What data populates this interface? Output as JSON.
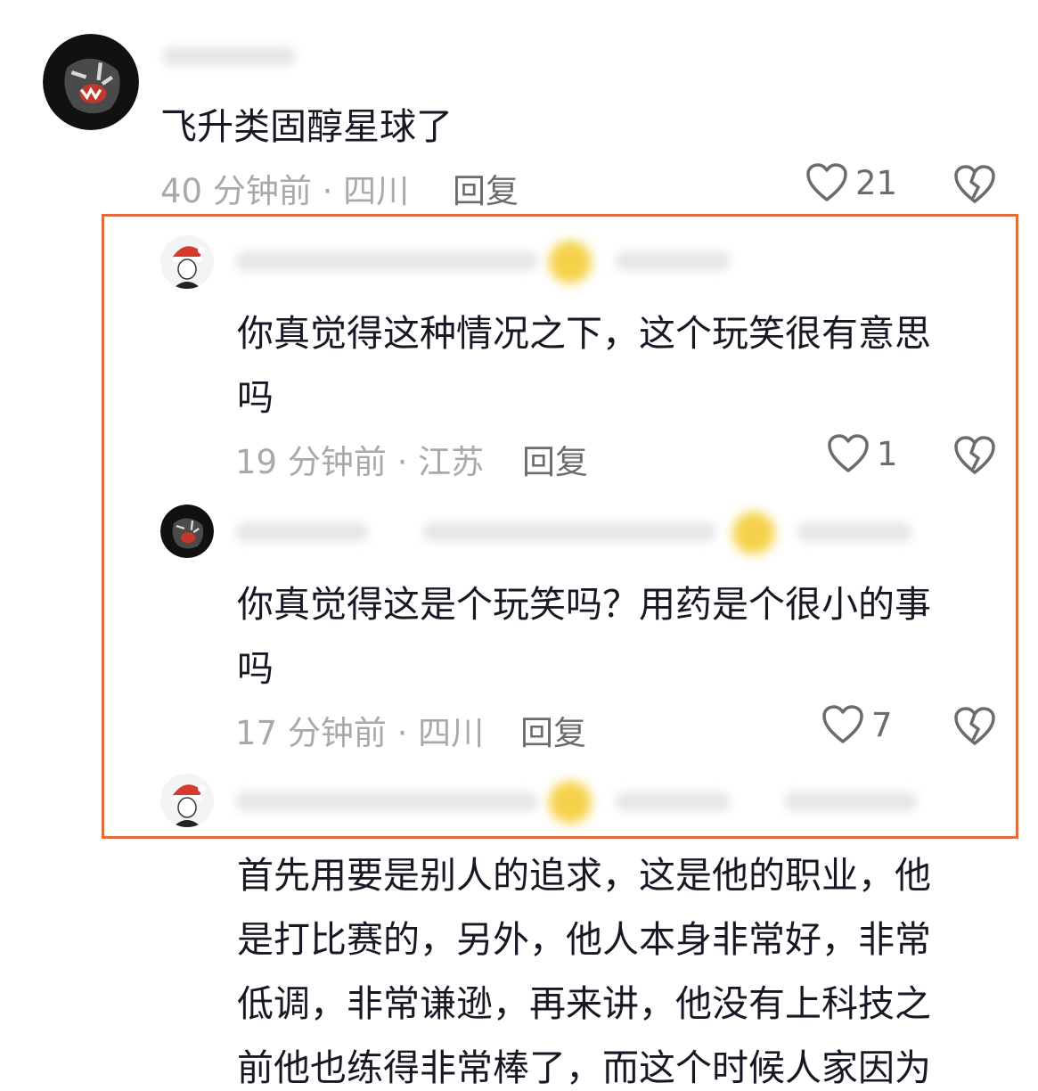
{
  "comments": [
    {
      "text_lines": [
        "飞升类固醇星球了"
      ],
      "time_loc": "40 分钟前 · 四川",
      "reply": "回复",
      "likes": "21"
    },
    {
      "text_lines": [
        "你真觉得这种情况之下，这个玩笑很有意思",
        "吗"
      ],
      "time_loc": "19 分钟前 · 江苏",
      "reply": "回复",
      "likes": "1"
    },
    {
      "text_lines": [
        "你真觉得这是个玩笑吗？用药是个很小的事",
        "吗"
      ],
      "time_loc": "17 分钟前 · 四川",
      "reply": "回复",
      "likes": "7"
    },
    {
      "text_lines": [
        "首先用要是别人的追求，这是他的职业，他",
        "是打比赛的，另外，他人本身非常好，非常",
        "低调，非常谦逊，再来讲，他没有上科技之",
        "前他也练得非常棒了，而这个时候人家因为"
      ]
    }
  ],
  "icons": {
    "like": "heart-outline-icon",
    "dislike": "broken-heart-icon"
  },
  "colors": {
    "highlight_border": "#e26b3c",
    "meta_text": "#a9a9ad",
    "action_text": "#6b6b70"
  }
}
